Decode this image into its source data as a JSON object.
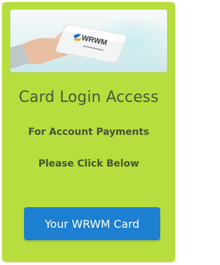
{
  "colors": {
    "panel_background": "#b7dd3e",
    "title_text": "#4a5636",
    "button_background": "#1c7fd1",
    "button_text": "#ffffff"
  },
  "hero": {
    "card_brand_text": "WRWM",
    "card_logo_icon": "card-logo-icon"
  },
  "panel": {
    "title": "Card Login Access",
    "line1": "For Account Payments",
    "line2": "Please Click Below",
    "button_label": "Your WRWM Card"
  }
}
